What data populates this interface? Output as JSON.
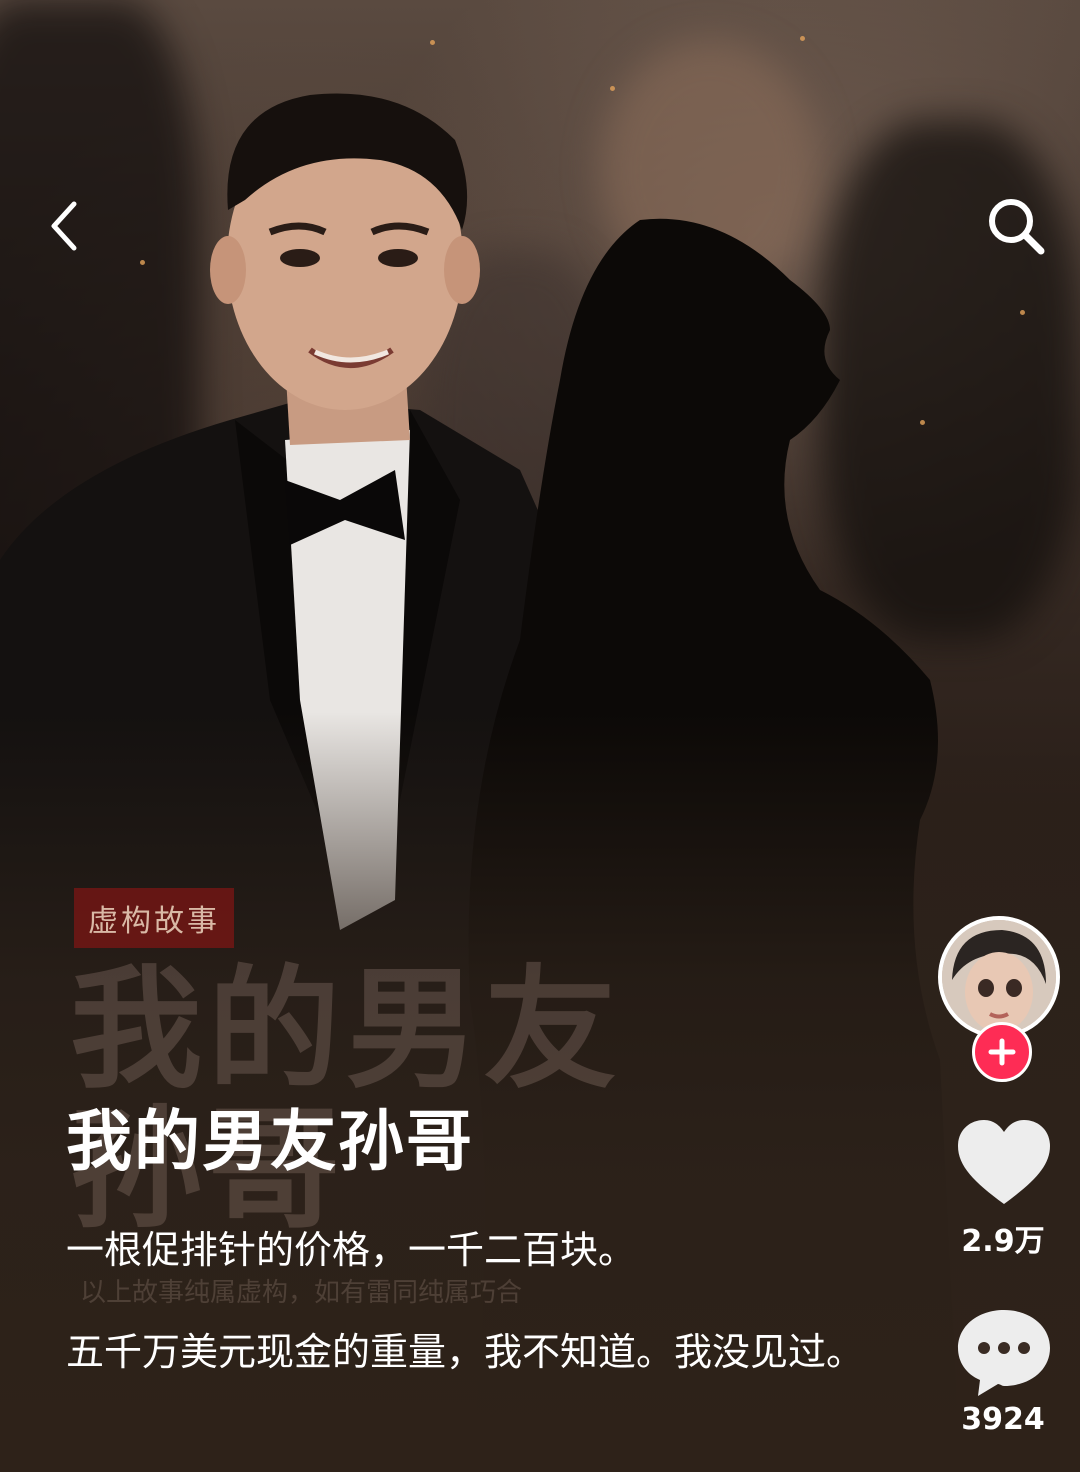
{
  "nav": {
    "back_icon": "chevron-left-icon",
    "search_icon": "search-icon"
  },
  "poster": {
    "tag": "虚构故事",
    "title_art": "我的男友孙哥",
    "disclaimer": "以上故事纯属虚构，如有雷同纯属巧合"
  },
  "post": {
    "title": "我的男友孙哥",
    "lines": [
      "一根促排针的价格，一千二百块。",
      "五千万美元现金的重量，我不知道。我没见过。"
    ]
  },
  "sidebar": {
    "avatar_icon": "avatar",
    "follow_icon": "plus-icon",
    "like_icon": "heart-icon",
    "like_count": "2.9万",
    "comment_icon": "comment-bubble-icon",
    "comment_count": "3924"
  },
  "colors": {
    "accent": "#fe2c55",
    "tag_bg": "#78161a",
    "background": "#2e2219"
  }
}
